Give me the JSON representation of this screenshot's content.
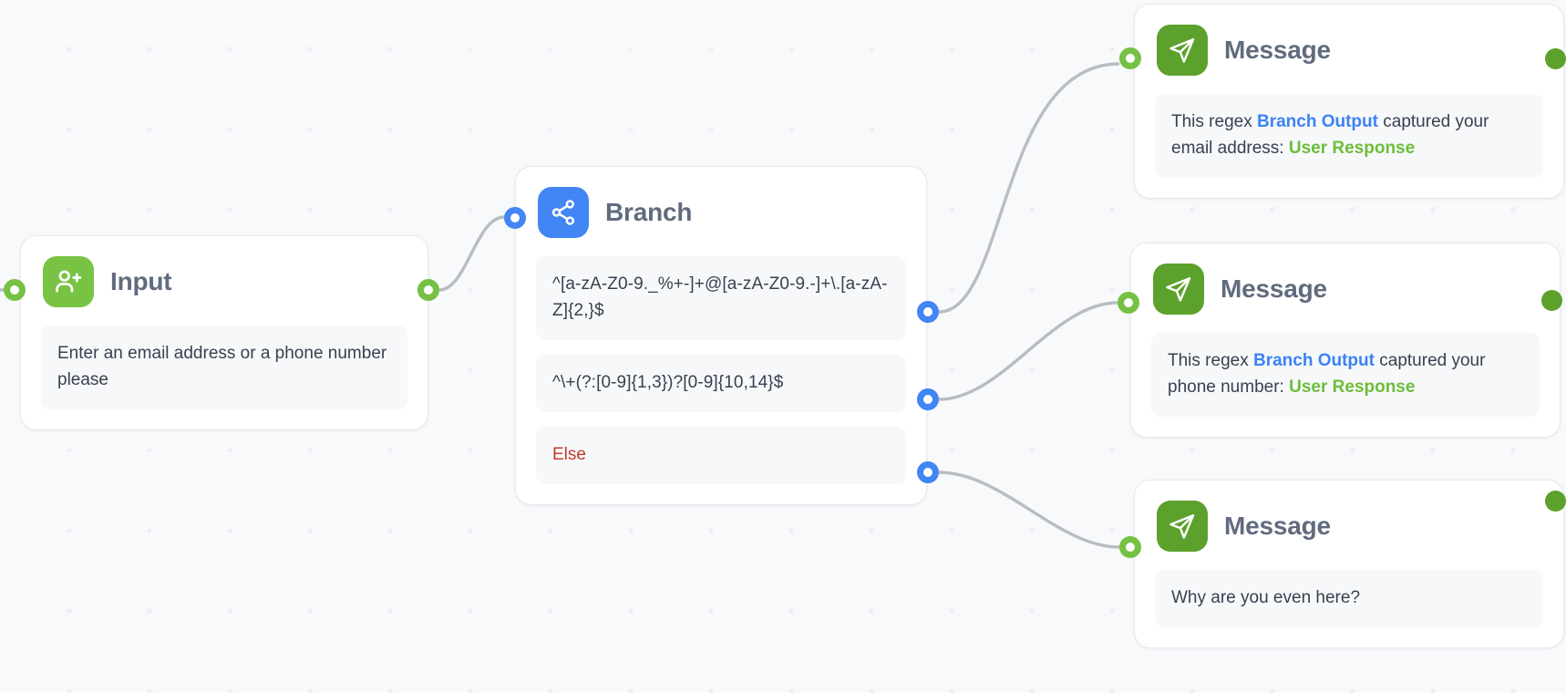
{
  "canvas": {
    "background_color": "#f7f9fb",
    "dot_color": "#eceef3",
    "edge_color": "#b9bcc2"
  },
  "nodes": [
    {
      "id": "input",
      "title": "Input",
      "icon": "person-add-icon",
      "icon_color": "#78c343",
      "fields": [
        {
          "text": "Enter an email address or a phone number please"
        }
      ]
    },
    {
      "id": "branch",
      "title": "Branch",
      "icon": "share-nodes-icon",
      "icon_color": "#4285f4",
      "fields": [
        {
          "text": "^[a-zA-Z0-9._%+-]+@[a-zA-Z0-9.-]+\\.[a-zA-Z]{2,}$"
        },
        {
          "text": "^\\+(?:[0-9]{1,3})?[0-9]{10,14}$"
        },
        {
          "text": "Else",
          "color": "#c23b2e"
        }
      ]
    },
    {
      "id": "message-1",
      "title": "Message",
      "icon": "send-icon",
      "icon_color": "#5ba12c",
      "message_parts": [
        {
          "text": "This regex ",
          "style": "plain"
        },
        {
          "text": "Branch Output",
          "style": "variable-blue"
        },
        {
          "text": " captured your email address: ",
          "style": "plain"
        },
        {
          "text": "User Response",
          "style": "variable-green"
        }
      ]
    },
    {
      "id": "message-2",
      "title": "Message",
      "icon": "send-icon",
      "icon_color": "#5ba12c",
      "message_parts": [
        {
          "text": "This regex ",
          "style": "plain"
        },
        {
          "text": "Branch Output",
          "style": "variable-blue"
        },
        {
          "text": " captured your phone number: ",
          "style": "plain"
        },
        {
          "text": "User Response",
          "style": "variable-green"
        }
      ]
    },
    {
      "id": "message-3",
      "title": "Message",
      "icon": "send-icon",
      "icon_color": "#5ba12c",
      "message_parts": [
        {
          "text": "Why are you even here?",
          "style": "plain"
        }
      ]
    }
  ],
  "ports": {
    "input_in": {
      "type": "ring",
      "color": "#76c144"
    },
    "input_out": {
      "type": "ring",
      "color": "#76c144"
    },
    "branch_in": {
      "type": "ring",
      "color": "#4285f4"
    },
    "branch_out_1": {
      "type": "ring",
      "color": "#4285f4"
    },
    "branch_out_2": {
      "type": "ring",
      "color": "#4285f4"
    },
    "branch_out_3": {
      "type": "ring",
      "color": "#4285f4"
    },
    "message_in": {
      "type": "ring",
      "color": "#76c144"
    },
    "message_out": {
      "type": "solid",
      "color": "#5ba12c"
    }
  },
  "text": {
    "input_title": "Input",
    "input_prompt": "Enter an email address or a phone number please",
    "branch_title": "Branch",
    "branch_regex_email": "^[a-zA-Z0-9._%+-]+@[a-zA-Z0-9.-]+\\.[a-zA-Z]{2,}$",
    "branch_regex_phone": "^\\+(?:[0-9]{1,3})?[0-9]{10,14}$",
    "branch_else": "Else",
    "message_title": "Message",
    "msg1_p1": "This regex ",
    "msg1_var1": "Branch Output",
    "msg1_p2": " captured your email address: ",
    "msg1_var2": "User Response",
    "msg2_p1": "This regex ",
    "msg2_var1": "Branch Output",
    "msg2_p2": " captured your phone number: ",
    "msg2_var2": "User Response",
    "msg3_p1": "Why are you even here?"
  }
}
